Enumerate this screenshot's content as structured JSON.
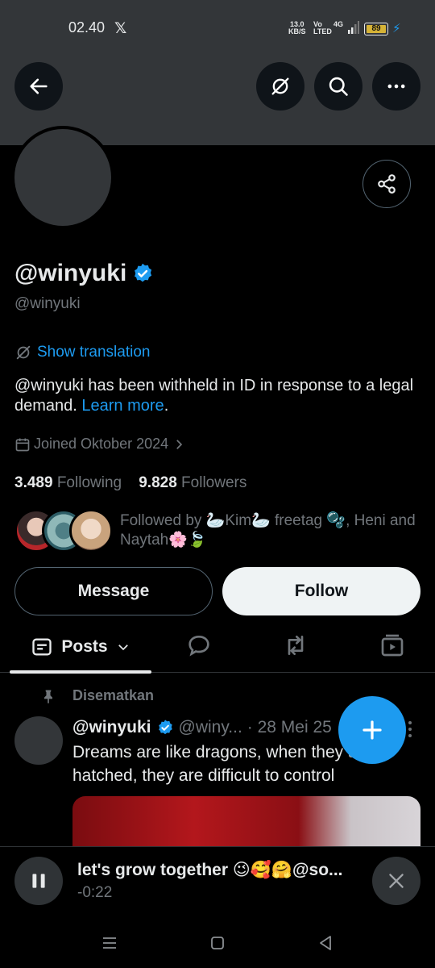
{
  "status_bar": {
    "time": "02.40",
    "app_icon": "x-logo",
    "net_speed_value": "13.0",
    "net_speed_unit": "KB/S",
    "volte_top": "Vo",
    "volte_bottom": "LTED",
    "network": "4G",
    "battery": "89",
    "charging_icon": "bolt-icon"
  },
  "header": {
    "back_icon": "arrow-left-icon",
    "translate_icon": "translate-off-icon",
    "search_icon": "search-icon",
    "more_icon": "more-horizontal-icon"
  },
  "profile": {
    "display_name": "@winyuki",
    "verified_icon": "verified-badge-icon",
    "handle": "@winyuki",
    "show_translation": "Show translation",
    "withheld_text": "@winyuki has been withheld in ID in response to a legal demand.",
    "learn_more": "Learn more",
    "withheld_period": ".",
    "joined": "Joined Oktober 2024",
    "following_count": "3.489",
    "following_label": "Following",
    "followers_count": "9.828",
    "followers_label": "Followers",
    "followed_by": "Followed by 🦢Kim🦢 freetag 🫧, Heni and Naytah🌸🍃"
  },
  "actions": {
    "message_label": "Message",
    "follow_label": "Follow"
  },
  "tabs": {
    "posts_label": "Posts"
  },
  "post": {
    "pinned_label": "Disematkan",
    "author": "@winyuki",
    "handle": "@winy...",
    "date": "· 28 Mei 25",
    "text": "Dreams are like dragons, when they are hatched, they are difficult to control"
  },
  "player": {
    "title": "let's grow together 😉🥰🤗@so...",
    "time": "-0:22"
  },
  "colors": {
    "accent": "#1d9bf0",
    "background": "#000000",
    "banner": "#333639",
    "muted": "#71767b"
  }
}
